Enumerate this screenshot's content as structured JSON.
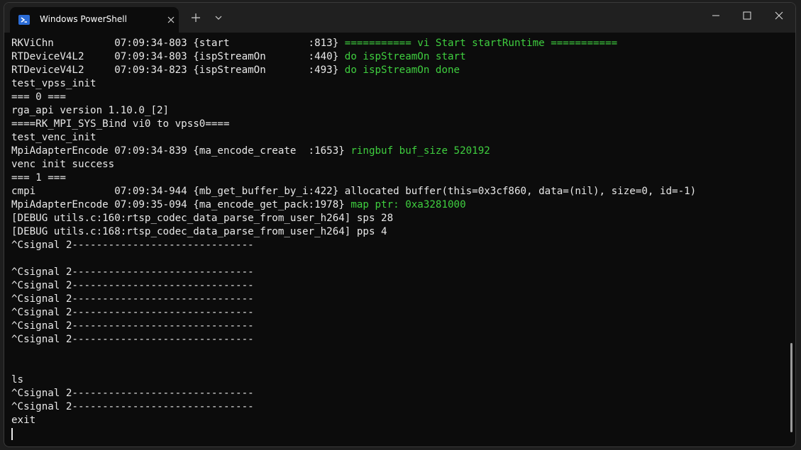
{
  "window": {
    "tab_title": "Windows PowerShell",
    "tab_icon": "powershell-icon",
    "close_tab_icon": "close-icon",
    "new_tab_icon": "plus-icon",
    "dropdown_icon": "chevron-down-icon"
  },
  "colors": {
    "terminal_bg": "#0c0c0c",
    "titlebar_bg": "#202020",
    "green_output": "#3fcf3f",
    "text": "#e8e8e8"
  },
  "terminal": {
    "lines": [
      {
        "text": "RKViChn          07:09:34-803 {start             :813} ",
        "green": "=========== vi Start startRuntime ==========="
      },
      {
        "text": "RTDeviceV4L2     07:09:34-803 {ispStreamOn       :440} ",
        "green": "do ispStreamOn start"
      },
      {
        "text": "RTDeviceV4L2     07:09:34-823 {ispStreamOn       :493} ",
        "green": "do ispStreamOn done"
      },
      {
        "text": "test_vpss_init",
        "green": ""
      },
      {
        "text": "=== 0 ===",
        "green": ""
      },
      {
        "text": "rga_api version 1.10.0_[2]",
        "green": ""
      },
      {
        "text": "====RK_MPI_SYS_Bind vi0 to vpss0====",
        "green": ""
      },
      {
        "text": "test_venc_init",
        "green": ""
      },
      {
        "text": "MpiAdapterEncode 07:09:34-839 {ma_encode_create  :1653} ",
        "green": "ringbuf buf_size 520192"
      },
      {
        "text": "venc init success",
        "green": ""
      },
      {
        "text": "=== 1 ===",
        "green": ""
      },
      {
        "text": "cmpi             07:09:34-944 {mb_get_buffer_by_i:422} allocated buffer(this=0x3cf860, data=(nil), size=0, id=-1)",
        "green": ""
      },
      {
        "text": "MpiAdapterEncode 07:09:35-094 {ma_encode_get_pack:1978} ",
        "green": "map ptr: 0xa3281000"
      },
      {
        "text": "[DEBUG utils.c:160:rtsp_codec_data_parse_from_user_h264] sps 28",
        "green": ""
      },
      {
        "text": "[DEBUG utils.c:168:rtsp_codec_data_parse_from_user_h264] pps 4",
        "green": ""
      },
      {
        "text": "^Csignal 2------------------------------",
        "green": ""
      },
      {
        "text": "",
        "green": ""
      },
      {
        "text": "^Csignal 2------------------------------",
        "green": ""
      },
      {
        "text": "^Csignal 2------------------------------",
        "green": ""
      },
      {
        "text": "^Csignal 2------------------------------",
        "green": ""
      },
      {
        "text": "^Csignal 2------------------------------",
        "green": ""
      },
      {
        "text": "^Csignal 2------------------------------",
        "green": ""
      },
      {
        "text": "^Csignal 2------------------------------",
        "green": ""
      },
      {
        "text": "",
        "green": ""
      },
      {
        "text": "",
        "green": ""
      },
      {
        "text": "ls",
        "green": ""
      },
      {
        "text": "^Csignal 2------------------------------",
        "green": ""
      },
      {
        "text": "^Csignal 2------------------------------",
        "green": ""
      },
      {
        "text": "exit",
        "green": ""
      }
    ]
  }
}
